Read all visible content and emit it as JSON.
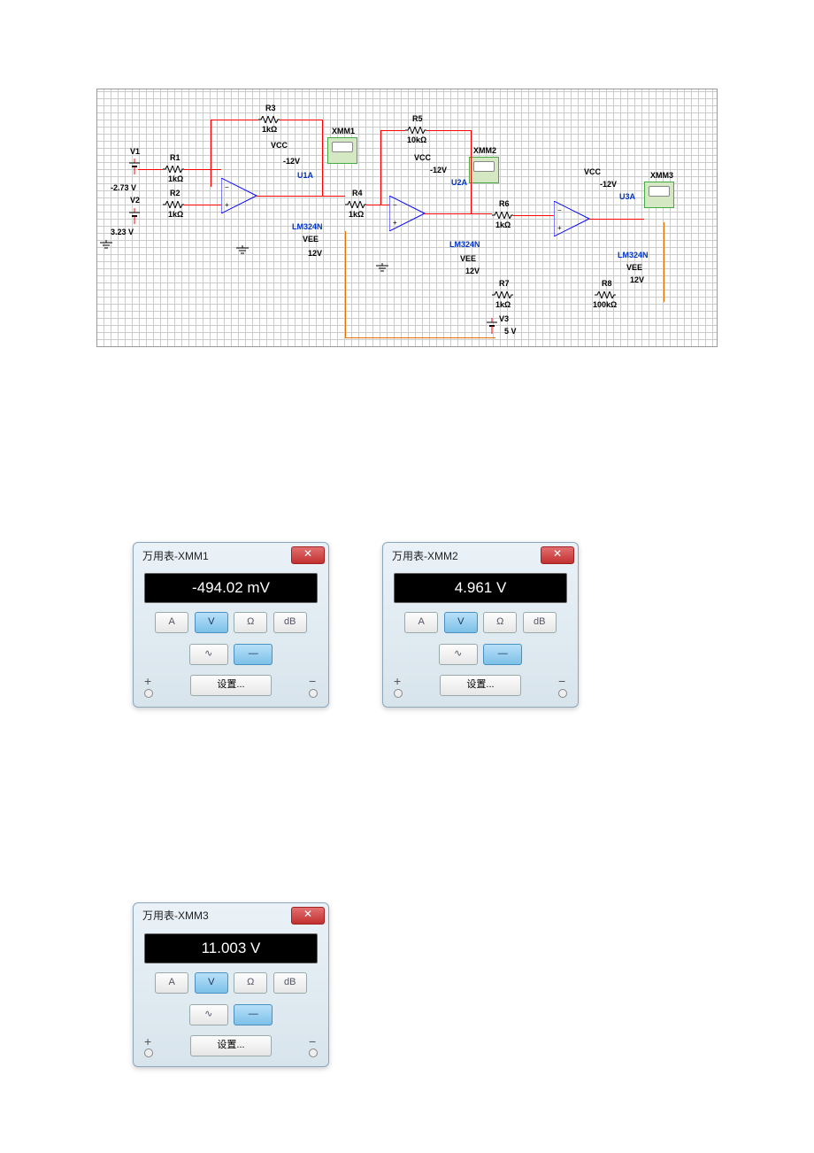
{
  "schematic": {
    "components": {
      "V1": {
        "ref": "V1",
        "val": "-2.73 V"
      },
      "V2": {
        "ref": "V2",
        "val": "3.23 V"
      },
      "V3": {
        "ref": "V3",
        "val": "5 V"
      },
      "R1": {
        "ref": "R1",
        "val": "1kΩ"
      },
      "R2": {
        "ref": "R2",
        "val": "1kΩ"
      },
      "R3": {
        "ref": "R3",
        "val": "1kΩ"
      },
      "R4": {
        "ref": "R4",
        "val": "1kΩ"
      },
      "R5": {
        "ref": "R5",
        "val": "10kΩ"
      },
      "R6": {
        "ref": "R6",
        "val": "1kΩ"
      },
      "R7": {
        "ref": "R7",
        "val": "1kΩ"
      },
      "R8": {
        "ref": "R8",
        "val": "100kΩ"
      },
      "U1": {
        "ref": "U1A",
        "model": "LM324N",
        "vcc": "VCC",
        "vee": "VEE",
        "vplus": "-12V",
        "vminus": "12V"
      },
      "U2": {
        "ref": "U2A",
        "model": "LM324N",
        "vcc": "VCC",
        "vee": "VEE",
        "vplus": "-12V",
        "vminus": "12V"
      },
      "U3": {
        "ref": "U3A",
        "model": "LM324N",
        "vcc": "VCC",
        "vee": "VEE",
        "vplus": "-12V",
        "vminus": "12V"
      },
      "XMM1": {
        "ref": "XMM1"
      },
      "XMM2": {
        "ref": "XMM2"
      },
      "XMM3": {
        "ref": "XMM3"
      }
    }
  },
  "multimeters": {
    "xmm1": {
      "title": "万用表-XMM1",
      "reading": "-494.02 mV",
      "modes": {
        "A": "A",
        "V": "V",
        "Ohm": "Ω",
        "dB": "dB"
      },
      "wave": {
        "ac": "∿",
        "dc": "—"
      },
      "settings": "设置...",
      "plus": "+",
      "minus": "−"
    },
    "xmm2": {
      "title": "万用表-XMM2",
      "reading": "4.961 V",
      "modes": {
        "A": "A",
        "V": "V",
        "Ohm": "Ω",
        "dB": "dB"
      },
      "wave": {
        "ac": "∿",
        "dc": "—"
      },
      "settings": "设置...",
      "plus": "+",
      "minus": "−"
    },
    "xmm3": {
      "title": "万用表-XMM3",
      "reading": "11.003 V",
      "modes": {
        "A": "A",
        "V": "V",
        "Ohm": "Ω",
        "dB": "dB"
      },
      "wave": {
        "ac": "∿",
        "dc": "—"
      },
      "settings": "设置...",
      "plus": "+",
      "minus": "−"
    }
  }
}
